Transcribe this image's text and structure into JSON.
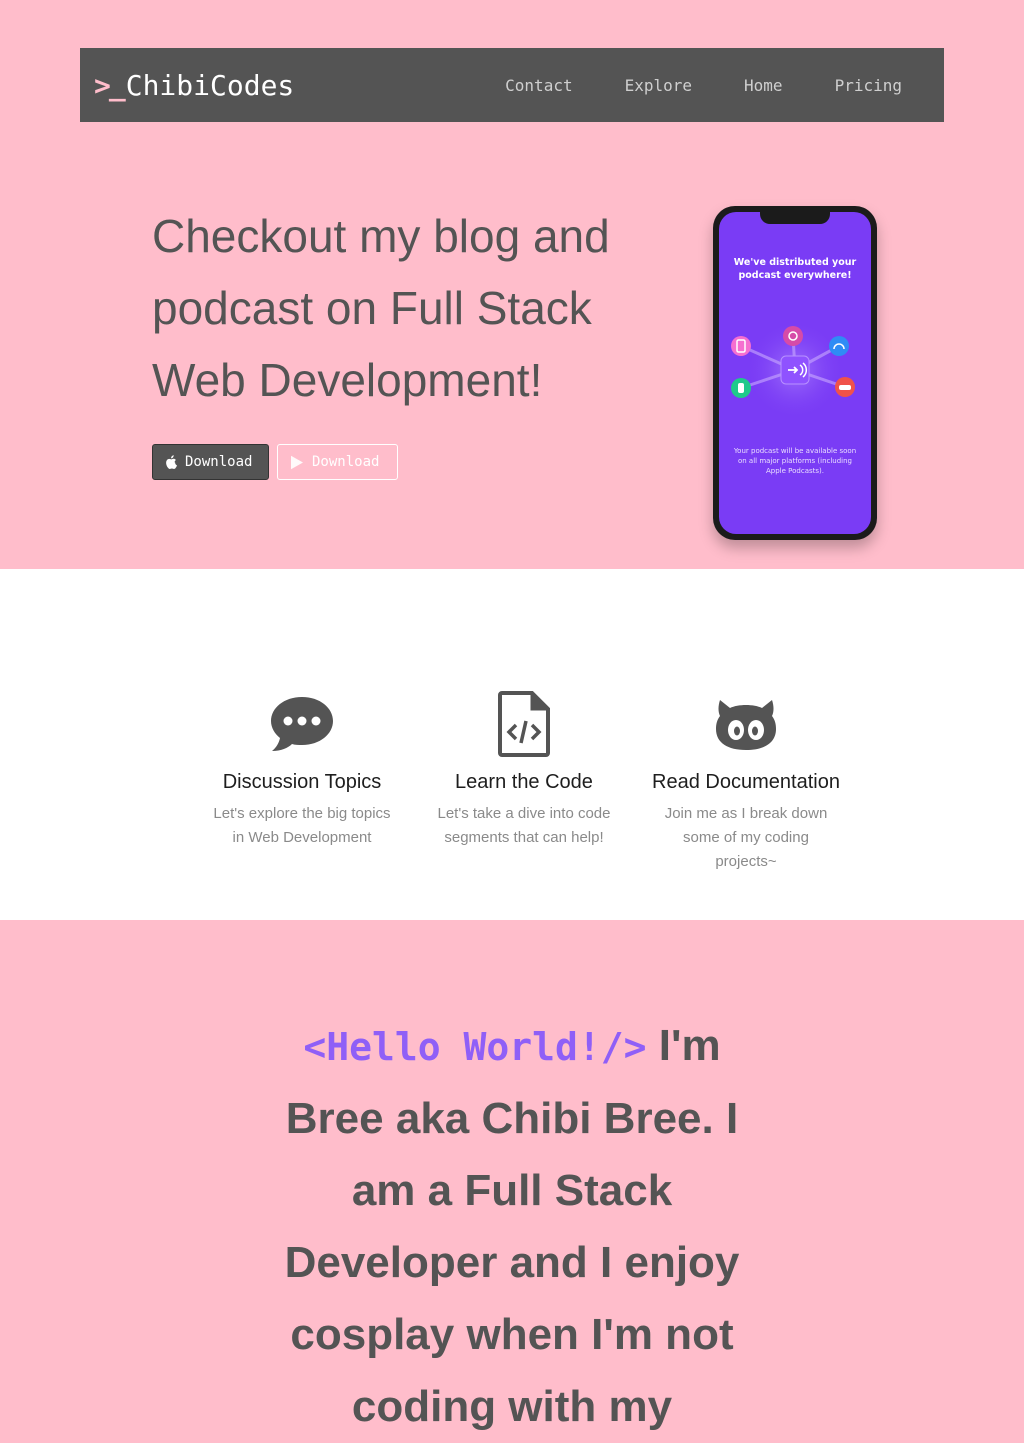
{
  "navbar": {
    "brand_prompt": ">_",
    "brand_name": "ChibiCodes",
    "links": [
      "Contact",
      "Explore",
      "Home",
      "Pricing"
    ]
  },
  "hero": {
    "title": "Checkout my blog and podcast on Full Stack Web Development!",
    "buttons": {
      "apple_label": "Download",
      "google_label": "Download"
    },
    "phone": {
      "screen_title": "We've distributed your podcast everywhere!",
      "screen_caption": "Your podcast will be available soon on all major platforms (including Apple Podcasts)."
    }
  },
  "features": [
    {
      "icon": "speech-bubble-icon",
      "title": "Discussion Topics",
      "desc": "Let's explore the big topics in Web Development"
    },
    {
      "icon": "file-code-icon",
      "title": "Learn the Code",
      "desc": "Let's take a dive into code segments that can help!"
    },
    {
      "icon": "github-icon",
      "title": "Read Documentation",
      "desc": "Join me as I break down some of my coding projects~"
    }
  ],
  "about": {
    "hello_tag": "<Hello World!/>",
    "text": " I'm Bree aka Chibi Bree. I am a Full Stack Developer and I enjoy cosplay when I'm not coding with my"
  },
  "colors": {
    "background_pink": "#ffbdcb",
    "navbar_gray": "#545454",
    "accent_purple": "#8f5ff7",
    "phone_screen_purple": "#7a3cf5"
  }
}
